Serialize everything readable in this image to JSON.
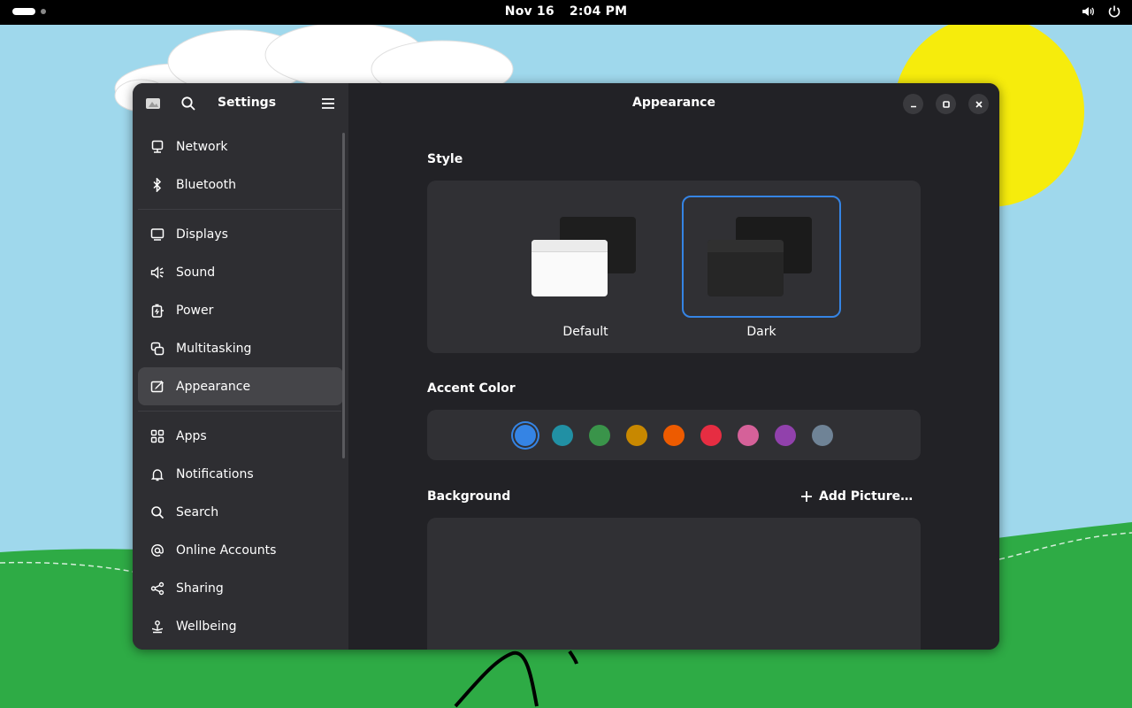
{
  "topbar": {
    "date": "Nov 16",
    "time": "2:04 PM",
    "volume_icon": "volume-icon",
    "power_icon": "power-icon"
  },
  "sidebar": {
    "title": "Settings",
    "items": [
      {
        "label": "Network",
        "icon": "network-icon"
      },
      {
        "label": "Bluetooth",
        "icon": "bluetooth-icon"
      },
      {
        "label": "Displays",
        "icon": "display-icon"
      },
      {
        "label": "Sound",
        "icon": "speaker-icon"
      },
      {
        "label": "Power",
        "icon": "battery-icon"
      },
      {
        "label": "Multitasking",
        "icon": "multitasking-icon"
      },
      {
        "label": "Appearance",
        "icon": "appearance-icon",
        "active": true
      },
      {
        "label": "Apps",
        "icon": "apps-grid-icon"
      },
      {
        "label": "Notifications",
        "icon": "bell-icon"
      },
      {
        "label": "Search",
        "icon": "search-icon"
      },
      {
        "label": "Online Accounts",
        "icon": "at-sign-icon"
      },
      {
        "label": "Sharing",
        "icon": "share-icon"
      },
      {
        "label": "Wellbeing",
        "icon": "wellbeing-icon"
      }
    ]
  },
  "content": {
    "title": "Appearance",
    "style": {
      "label": "Style",
      "options": [
        {
          "label": "Default",
          "selected": false
        },
        {
          "label": "Dark",
          "selected": true
        }
      ]
    },
    "accent": {
      "label": "Accent Color",
      "colors": [
        "#3584e4",
        "#2190a4",
        "#3a944a",
        "#c88800",
        "#ed5b00",
        "#e62d42",
        "#d56199",
        "#9141ac",
        "#6f8396"
      ],
      "selected_index": 0
    },
    "background": {
      "label": "Background",
      "add_label": "Add Picture…"
    }
  },
  "colors": {
    "accent": "#3584e4",
    "sidebar_bg": "#2e2e32",
    "content_bg": "#222226",
    "card_bg": "#303034"
  }
}
